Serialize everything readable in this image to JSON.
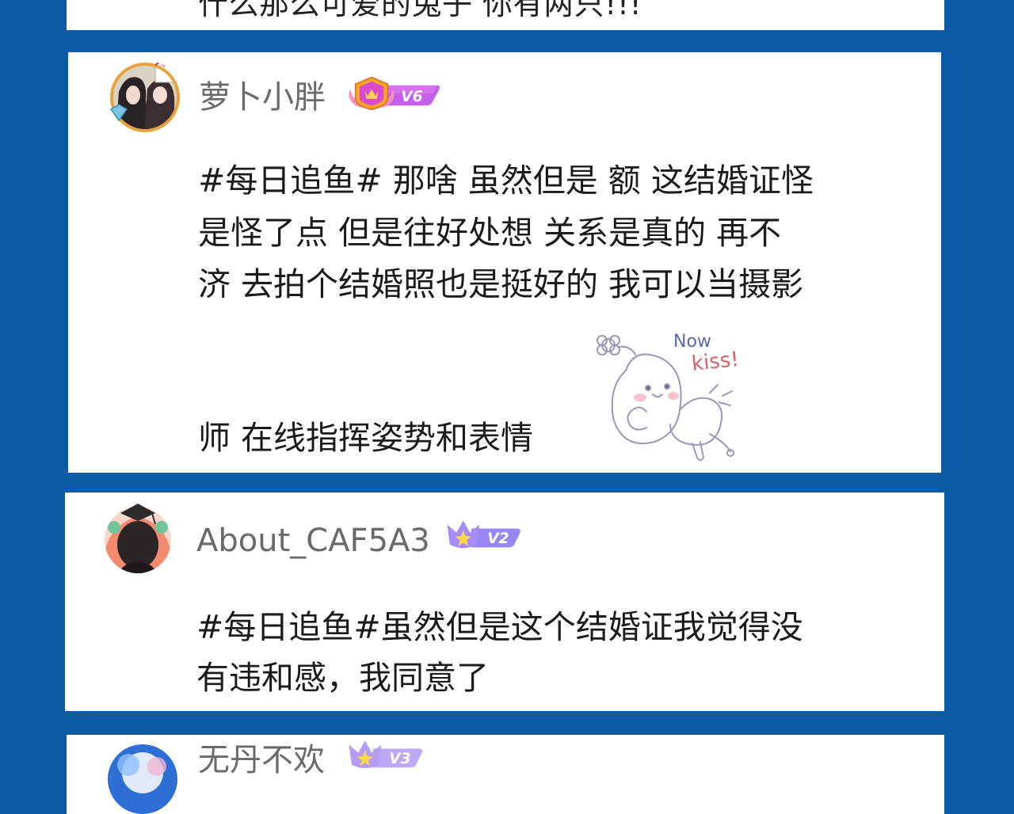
{
  "colors": {
    "background": "#0b5ba7",
    "card": "#ffffff",
    "username": "#6a6a6a",
    "text": "#1b1b1b",
    "badge_v6": "#d65cf0",
    "badge_v2": "#8f79f5",
    "badge_v3": "#b6a4f6"
  },
  "top_card": {
    "text": "什么那么可爱的兔子 你有两只!!!"
  },
  "comments": [
    {
      "username": "萝卜小胖",
      "level": "V6",
      "avatar_icon": "anime-avatar-diamond-frame",
      "lines": [
        "#每日追鱼# 那啥 虽然但是 额 这结婚证怪",
        "是怪了点 但是往好处想 关系是真的 再不",
        "济 去拍个结婚照也是挺好的 我可以当摄影",
        "师 在线指挥姿势和表情"
      ],
      "sticker": {
        "icon": "bunny-kiss-sticker",
        "text_1": "Now",
        "text_2": "kiss!"
      }
    },
    {
      "username": "About_CAF5A3",
      "level": "V2",
      "avatar_icon": "anime-girl-graduation-cap-avatar",
      "lines": [
        "#每日追鱼#虽然但是这个结婚证我觉得没",
        "有违和感，我同意了"
      ]
    },
    {
      "username": "无丹不欢",
      "level": "V3",
      "avatar_icon": "blue-anime-avatar"
    }
  ]
}
